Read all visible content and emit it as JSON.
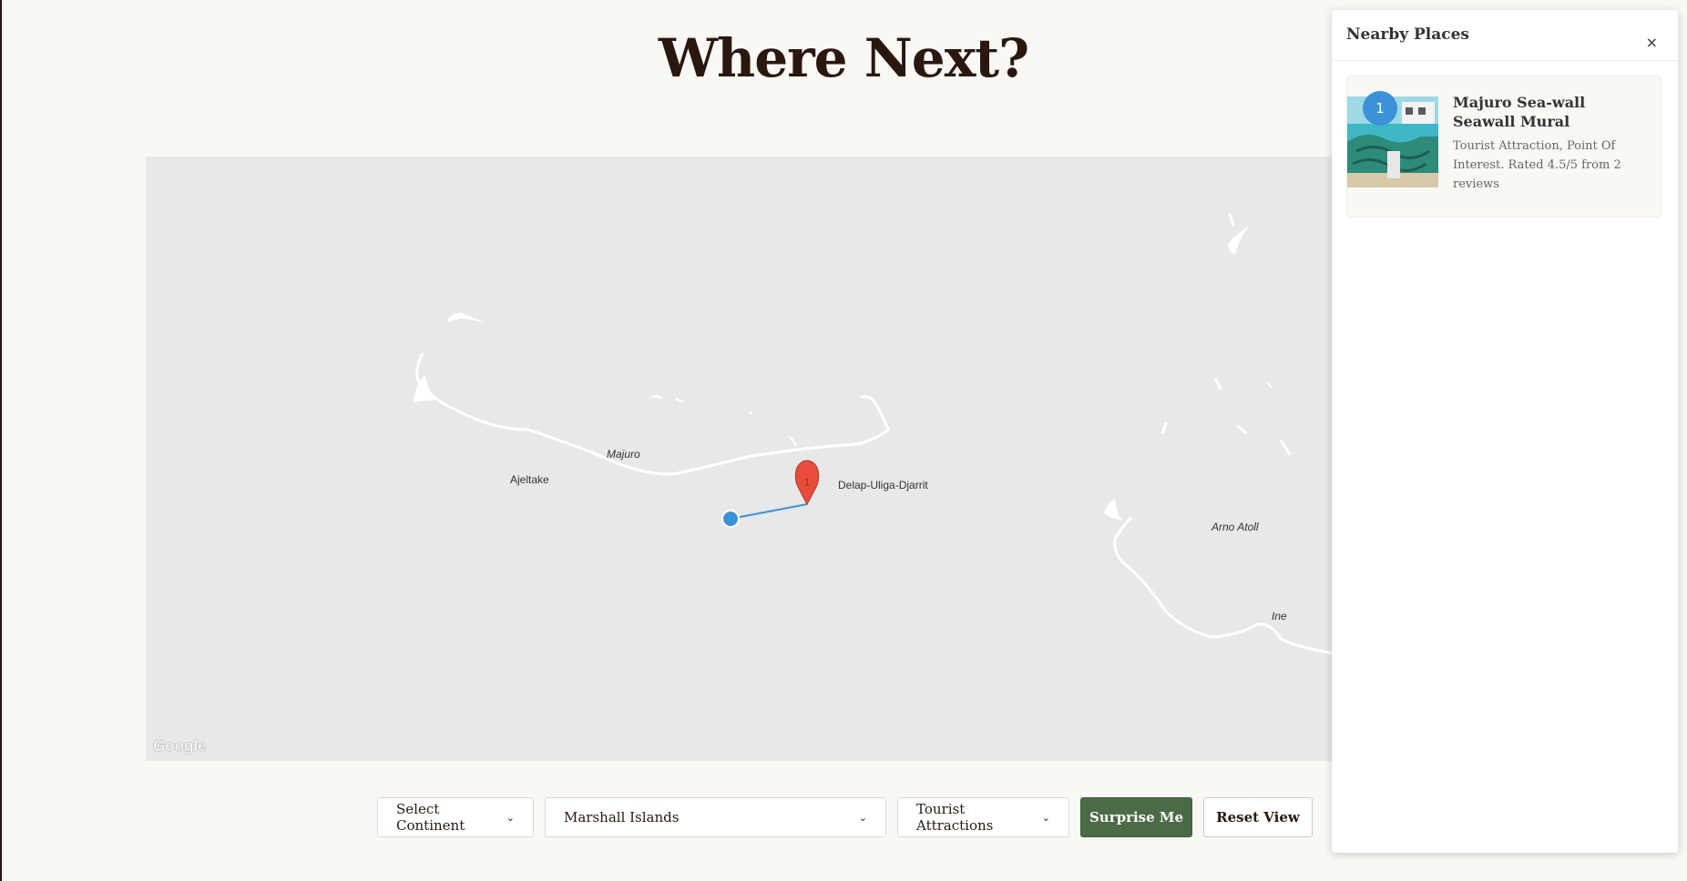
{
  "page": {
    "title": "Where Next?"
  },
  "map": {
    "labels": {
      "majuro": "Majuro",
      "ajeltake": "Ajeltake",
      "delap": "Delap-Uliga-Djarrit",
      "arno": "Arno Atoll",
      "ine": "Ine"
    },
    "marker_number": "1",
    "attribution": "Google",
    "colors": {
      "land": "#e8e8e8",
      "water_lines": "#ffffff",
      "marker": "#e74c3c",
      "user_dot": "#3a93d6"
    }
  },
  "controls": {
    "continent_select": "Select Continent",
    "country_select": "Marshall Islands",
    "category_select": "Tourist Attractions",
    "surprise_label": "Surprise Me",
    "reset_label": "Reset View",
    "surprise_color": "#4a6b45"
  },
  "panel": {
    "title": "Nearby Places",
    "close_icon": "×",
    "places": [
      {
        "badge": "1",
        "name": "Majuro Sea-wall Seawall Mural",
        "description": "Tourist Attraction, Point Of Interest. Rated 4.5/5 from 2 reviews"
      }
    ]
  }
}
